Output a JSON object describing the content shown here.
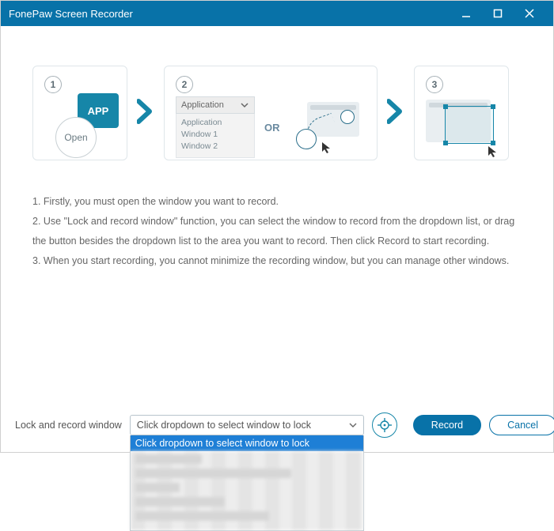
{
  "window": {
    "title": "FonePaw Screen Recorder"
  },
  "steps": {
    "s1": {
      "num": "1",
      "badge": "APP",
      "open": "Open"
    },
    "s2": {
      "num": "2",
      "dd_label": "Application",
      "dd_items": [
        "Application",
        "Window 1",
        "Window 2"
      ],
      "or": "OR"
    },
    "s3": {
      "num": "3"
    }
  },
  "instructions": {
    "l1": "1. Firstly, you must open the window you want to record.",
    "l2": "2. Use \"Lock and record window\" function, you can select the window to record from the dropdown list, or drag the button besides the dropdown list to the area you want to record. Then click Record to start recording.",
    "l3": "3. When you start recording, you cannot minimize the recording window, but you can manage other windows."
  },
  "bottom": {
    "label": "Lock and record window",
    "placeholder": "Click dropdown to select window to lock",
    "selected": "Click dropdown to select window to lock",
    "record": "Record",
    "cancel": "Cancel"
  }
}
